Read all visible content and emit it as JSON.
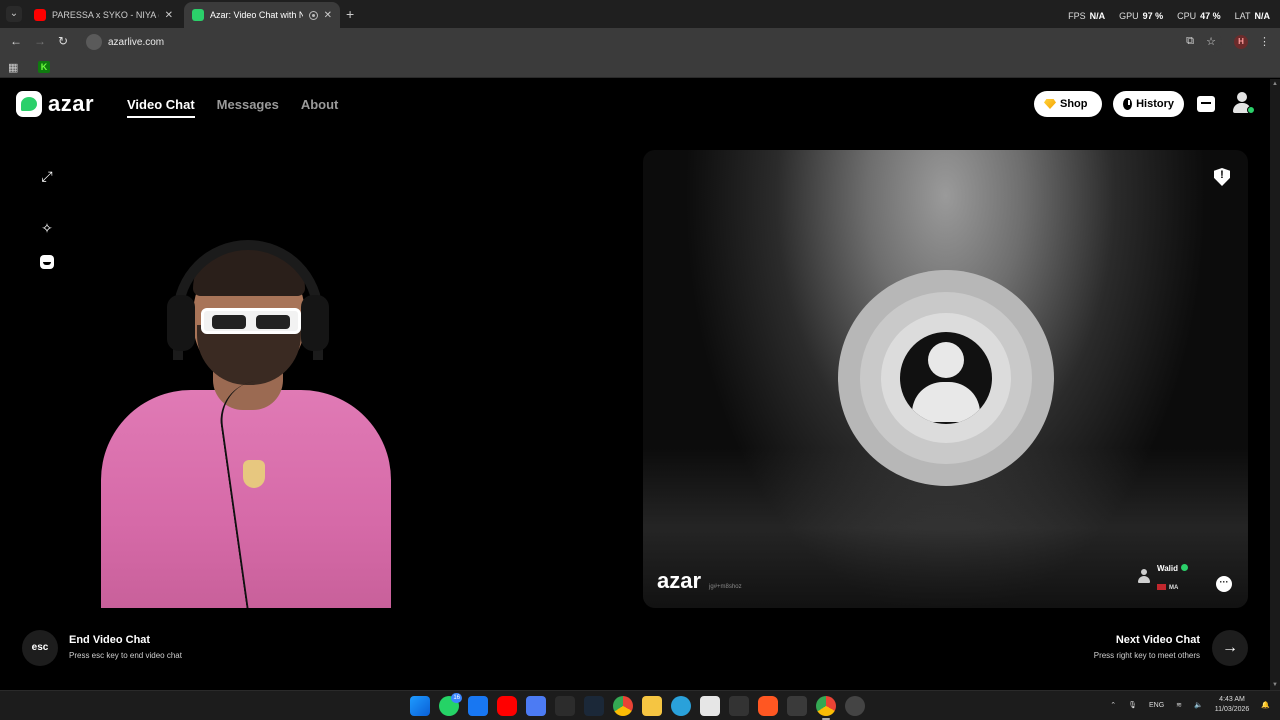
{
  "browser": {
    "tabs": [
      {
        "title": "PARESSA x SYKO - NIYA (Prod",
        "favicon": "youtube-icon",
        "active": false
      },
      {
        "title": "Azar: Video Chat with New",
        "favicon": "azar-icon",
        "active": true
      }
    ],
    "new_tab_label": "+",
    "stats": {
      "fps_label": "FPS",
      "fps_value": "N/A",
      "gpu_label": "GPU",
      "gpu_value": "97 %",
      "cpu_label": "CPU",
      "cpu_value": "47 %",
      "lat_label": "LAT",
      "lat_value": "N/A"
    },
    "url": "azarlive.com",
    "profile_initial": "H"
  },
  "header": {
    "logo_text": "azar",
    "nav": [
      {
        "label": "Video Chat",
        "active": true
      },
      {
        "label": "Messages",
        "active": false
      },
      {
        "label": "About",
        "active": false
      }
    ],
    "shop_label": "Shop",
    "history_label": "History"
  },
  "remote": {
    "watermark": "azar",
    "watermark_id": "jg#+m8shoz",
    "peer_name": "Walid",
    "peer_country": "MA"
  },
  "footer": {
    "esc_label": "esc",
    "end_title": "End Video Chat",
    "end_subtitle": "Press esc key to end video chat",
    "next_title": "Next Video Chat",
    "next_subtitle": "Press right key to meet others"
  },
  "taskbar": {
    "whatsapp_badge": "16",
    "language": "ENG",
    "time": "4:43 AM",
    "date": "11/03/2026"
  },
  "colors": {
    "accent_green": "#2bd06a",
    "chrome_bg": "#1f1f1f",
    "page_bg": "#000000"
  }
}
